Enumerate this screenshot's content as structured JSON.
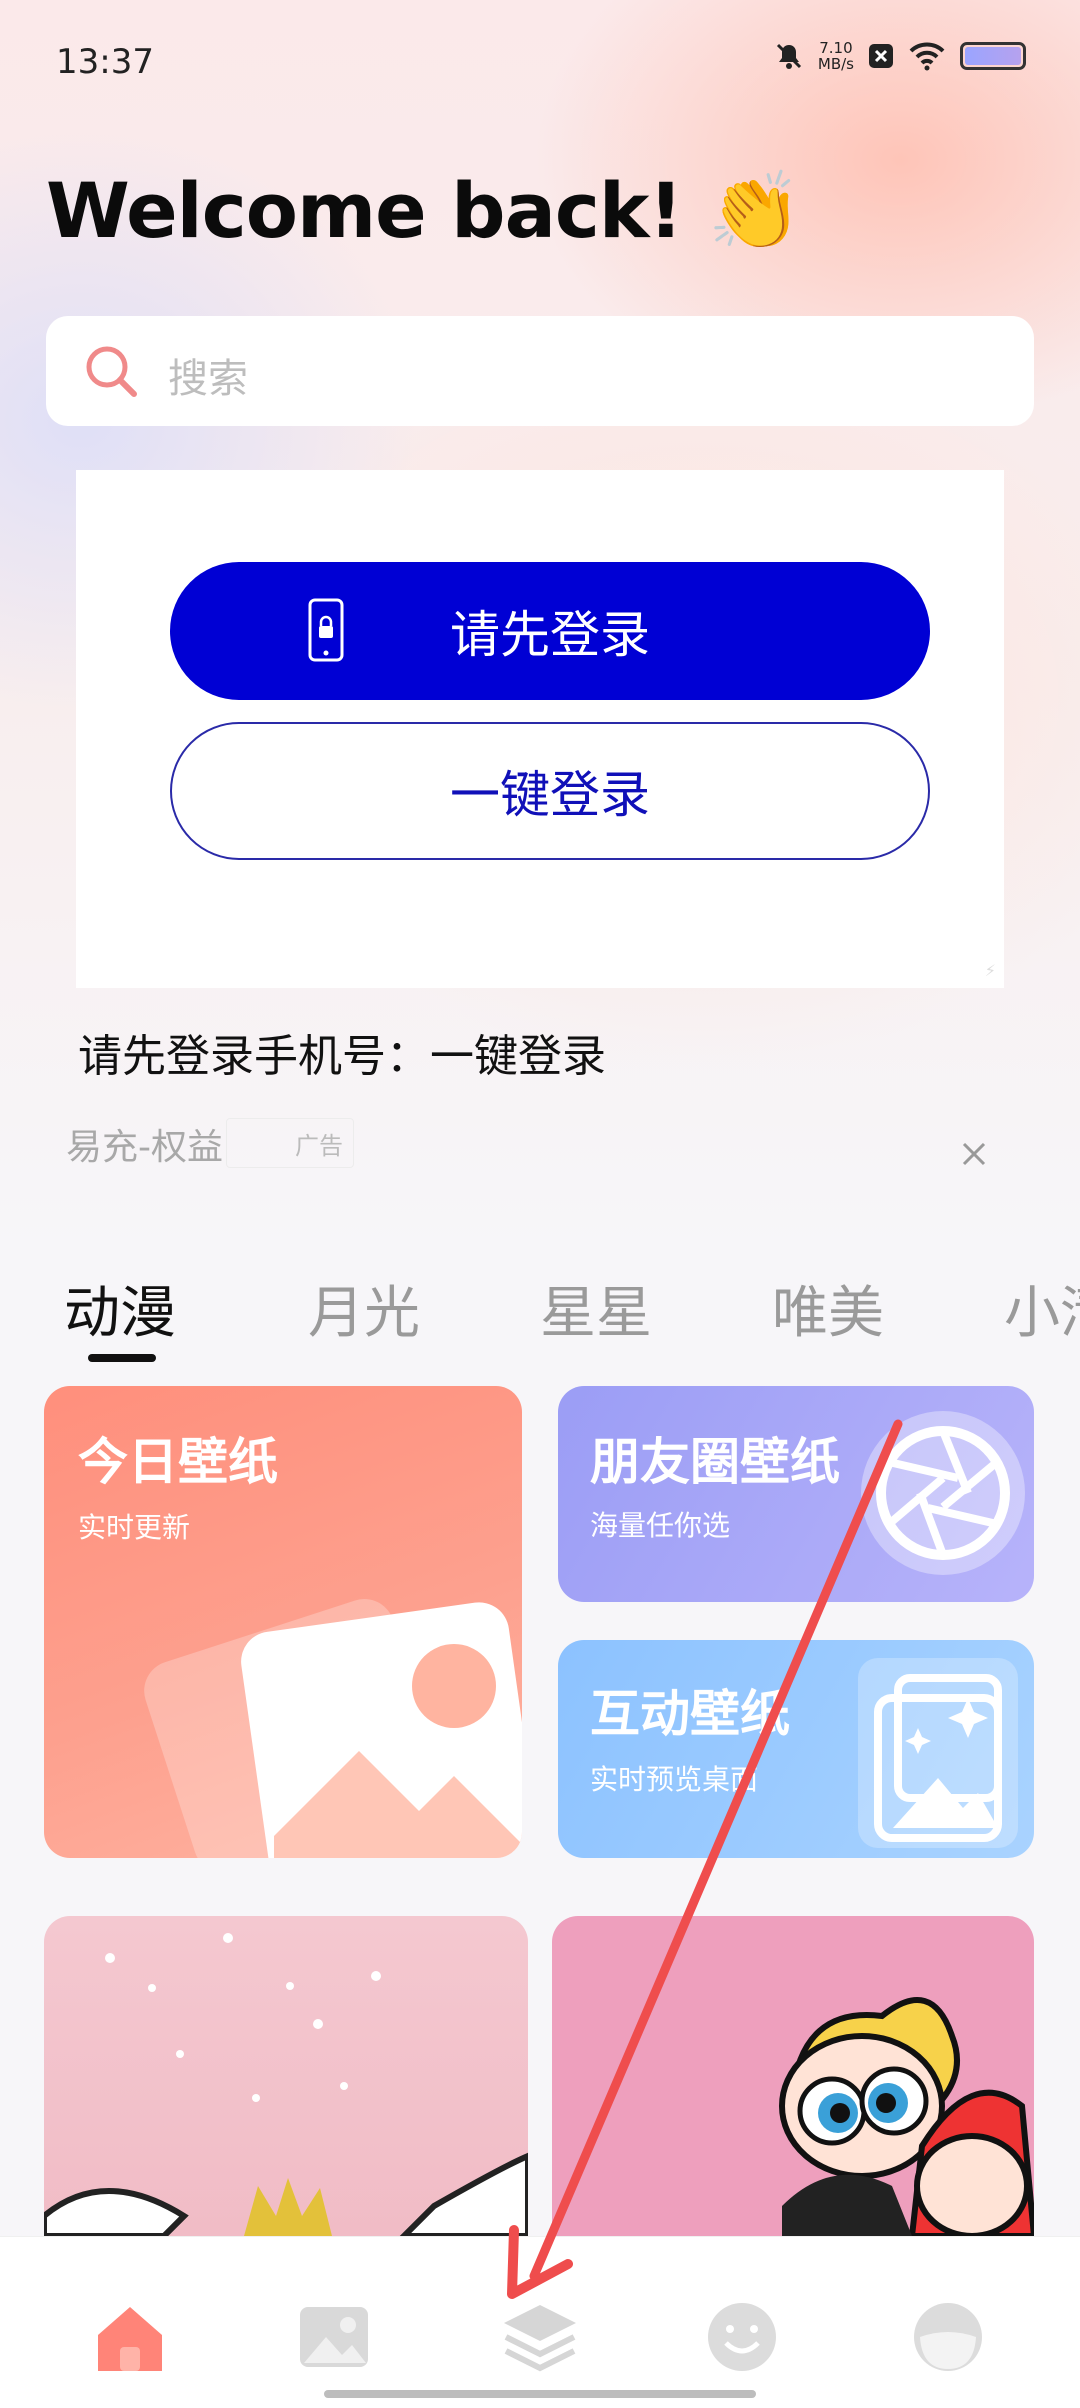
{
  "status_bar": {
    "time": "13:37",
    "speed_value": "7.10",
    "speed_unit": "MB/s",
    "icons": [
      "mute-bell-icon",
      "close-notification-icon",
      "wifi-icon",
      "battery-icon"
    ]
  },
  "header": {
    "welcome": "Welcome back!",
    "emoji": "👏"
  },
  "search": {
    "placeholder": "搜索"
  },
  "ad": {
    "primary_button": "请先登录",
    "secondary_button": "一键登录",
    "title": "请先登录手机号：一键登录",
    "source": "易充-权益",
    "badge": "广告"
  },
  "tabs": [
    {
      "label": "动漫",
      "active": true
    },
    {
      "label": "月光",
      "active": false
    },
    {
      "label": "星星",
      "active": false
    },
    {
      "label": "唯美",
      "active": false
    },
    {
      "label": "小清",
      "active": false
    }
  ],
  "cards": {
    "today": {
      "title": "今日壁纸",
      "subtitle": "实时更新"
    },
    "moments": {
      "title": "朋友圈壁纸",
      "subtitle": "海量任你选"
    },
    "interactive": {
      "title": "互动壁纸",
      "subtitle": "实时预览桌面"
    }
  },
  "bottom_nav": [
    {
      "name": "home-icon",
      "active": true
    },
    {
      "name": "gallery-icon",
      "active": false
    },
    {
      "name": "layers-icon",
      "active": false
    },
    {
      "name": "smile-icon",
      "active": false
    },
    {
      "name": "profile-icon",
      "active": false
    }
  ],
  "colors": {
    "primary_button": "#0000d4",
    "accent_home": "#ff7f72",
    "annotation_arrow": "#ef4d4d"
  }
}
